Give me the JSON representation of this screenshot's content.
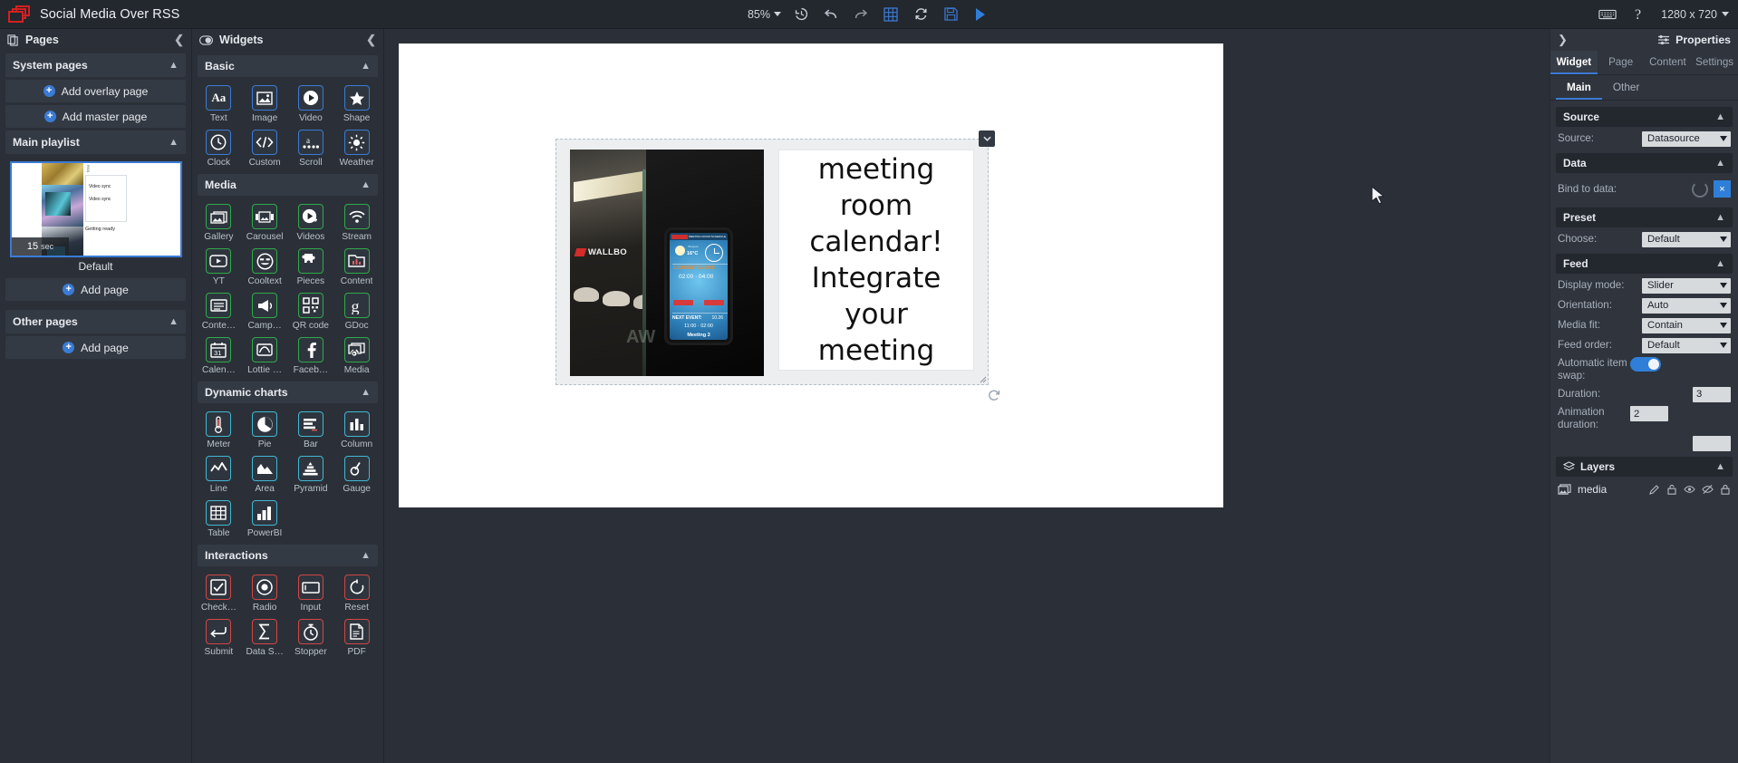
{
  "topbar": {
    "app_title": "Social Media Over RSS",
    "zoom": "85%",
    "resolution": "1280 x 720",
    "icons": [
      "history-icon",
      "undo-icon",
      "redo-icon",
      "grid-icon",
      "refresh-icon",
      "save-icon",
      "play-icon"
    ],
    "right_icons": [
      "keyboard-icon",
      "help-icon"
    ]
  },
  "pages": {
    "title": "Pages",
    "sections": [
      {
        "label": "System pages"
      },
      {
        "label": "Main playlist"
      },
      {
        "label": "Other pages"
      }
    ],
    "add_overlay": "Add overlay page",
    "add_master": "Add master page",
    "add_page": "Add page",
    "add_page_other": "Add page",
    "thumb": {
      "duration": "15",
      "duration_unit": "sec",
      "name": "Default",
      "card_line1": "Video sync",
      "card_line2": "Video sync",
      "getting_ready": "Getting ready"
    }
  },
  "widgets": {
    "title": "Widgets",
    "groups": [
      {
        "label": "Basic",
        "color": "#3a7bd5",
        "items": [
          {
            "label": "Text",
            "icon": "text-icon"
          },
          {
            "label": "Image",
            "icon": "image-icon"
          },
          {
            "label": "Video",
            "icon": "video-icon"
          },
          {
            "label": "Shape",
            "icon": "star-shape-icon"
          },
          {
            "label": "Clock",
            "icon": "clock-icon"
          },
          {
            "label": "Custom",
            "icon": "code-icon"
          },
          {
            "label": "Scroll",
            "icon": "scroll-icon"
          },
          {
            "label": "Weather",
            "icon": "weather-sun-icon"
          }
        ]
      },
      {
        "label": "Media",
        "color": "#2faa4a",
        "items": [
          {
            "label": "Gallery",
            "icon": "gallery-icon"
          },
          {
            "label": "Carousel",
            "icon": "carousel-icon"
          },
          {
            "label": "Videos",
            "icon": "videos-icon"
          },
          {
            "label": "Stream",
            "icon": "stream-wifi-icon"
          },
          {
            "label": "YT",
            "icon": "youtube-icon"
          },
          {
            "label": "Cooltext",
            "icon": "cooltext-smiley-icon"
          },
          {
            "label": "Pieces",
            "icon": "puzzle-piece-icon"
          },
          {
            "label": "Content",
            "icon": "content-folder-icon"
          },
          {
            "label": "Conte…",
            "icon": "content-alt-icon"
          },
          {
            "label": "Camp…",
            "icon": "campaign-icon"
          },
          {
            "label": "QR code",
            "icon": "qr-code-icon"
          },
          {
            "label": "GDoc",
            "icon": "google-doc-icon"
          },
          {
            "label": "Calen…",
            "icon": "calendar-icon"
          },
          {
            "label": "Lottie …",
            "icon": "lottie-icon"
          },
          {
            "label": "Faceb…",
            "icon": "facebook-icon"
          },
          {
            "label": "Media",
            "icon": "media-icon"
          }
        ]
      },
      {
        "label": "Dynamic charts",
        "color": "#3fb8d4",
        "items": [
          {
            "label": "Meter",
            "icon": "meter-icon"
          },
          {
            "label": "Pie",
            "icon": "pie-chart-icon"
          },
          {
            "label": "Bar",
            "icon": "bar-chart-icon"
          },
          {
            "label": "Column",
            "icon": "column-chart-icon"
          },
          {
            "label": "Line",
            "icon": "line-chart-icon"
          },
          {
            "label": "Area",
            "icon": "area-chart-icon"
          },
          {
            "label": "Pyramid",
            "icon": "pyramid-chart-icon"
          },
          {
            "label": "Gauge",
            "icon": "gauge-icon"
          },
          {
            "label": "Table",
            "icon": "table-icon"
          },
          {
            "label": "PowerBI",
            "icon": "powerbi-icon"
          }
        ]
      },
      {
        "label": "Interactions",
        "color": "#d24545",
        "items": [
          {
            "label": "Check…",
            "icon": "checkbox-icon"
          },
          {
            "label": "Radio",
            "icon": "radio-button-icon"
          },
          {
            "label": "Input",
            "icon": "input-field-icon"
          },
          {
            "label": "Reset",
            "icon": "reset-icon"
          },
          {
            "label": "Submit",
            "icon": "submit-icon"
          },
          {
            "label": "Data S…",
            "icon": "data-sum-icon"
          },
          {
            "label": "Stopper",
            "icon": "stopwatch-icon"
          },
          {
            "label": "PDF",
            "icon": "pdf-icon"
          }
        ]
      }
    ]
  },
  "canvas": {
    "text_widget": "Integrate your meeting room calendar! Integrate your meeting room calendar!",
    "image_widget": {
      "wall_logo": "WALLBO",
      "tablet": {
        "header_right": "MEETING ROOM SCHEDULE",
        "temp_title": "Tampere",
        "temperature": "16°C",
        "current_label": "CURRENT EVENT:",
        "current_time": "02:00 · 04:00",
        "next_label": "NEXT EVENT:",
        "next_date": "10.26",
        "next_time": "11:00 · 02:00",
        "meeting_name": "Meeting 3"
      }
    }
  },
  "properties": {
    "title": "Properties",
    "tabs": [
      {
        "label": "Widget",
        "active": true
      },
      {
        "label": "Page",
        "active": false
      },
      {
        "label": "Content",
        "active": false
      },
      {
        "label": "Settings",
        "active": false
      }
    ],
    "subtabs": [
      {
        "label": "Main",
        "active": true
      },
      {
        "label": "Other",
        "active": false
      }
    ],
    "sections": {
      "source": {
        "label": "Source",
        "source_label": "Source:",
        "source_value": "Datasource"
      },
      "data": {
        "label": "Data",
        "bind_label": "Bind to data:",
        "clear_button": "×"
      },
      "preset": {
        "label": "Preset",
        "choose_label": "Choose:",
        "choose_value": "Default"
      },
      "feed": {
        "label": "Feed",
        "display_mode_label": "Display mode:",
        "display_mode_value": "Slider",
        "orientation_label": "Orientation:",
        "orientation_value": "Auto",
        "media_fit_label": "Media fit:",
        "media_fit_value": "Contain",
        "feed_order_label": "Feed order:",
        "feed_order_value": "Default",
        "auto_swap_label": "Automatic item swap:",
        "duration_label": "Duration:",
        "duration_value": "3",
        "animation_label": "Animation duration:",
        "animation_value": "2"
      },
      "layers": {
        "label": "Layers",
        "items": [
          {
            "name": "media",
            "icons": [
              "pencil-icon",
              "lock-open-icon",
              "eye-icon",
              "eye-off-icon",
              "unlock-icon"
            ]
          }
        ]
      }
    }
  }
}
